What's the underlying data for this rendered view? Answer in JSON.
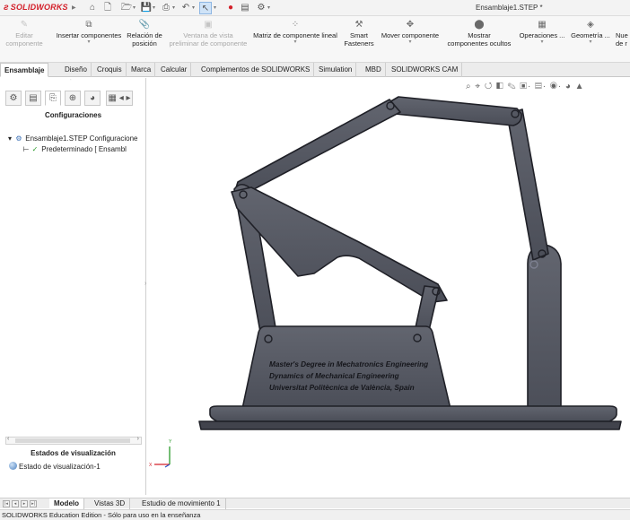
{
  "app": {
    "logo_text": "SOLIDWORKS",
    "window_title": "Ensamblaje1.STEP *"
  },
  "commands": [
    {
      "label_1": "Editar",
      "label_2": "componente",
      "icon": "edit-component-icon",
      "enabled": false
    },
    {
      "label_1": "Insertar componentes",
      "label_2": "",
      "icon": "insert-components-icon",
      "enabled": true
    },
    {
      "label_1": "Relación de",
      "label_2": "posición",
      "icon": "mate-icon",
      "enabled": true
    },
    {
      "label_1": "Ventana de vista",
      "label_2": "preliminar de componente",
      "icon": "preview-window-icon",
      "enabled": false
    },
    {
      "label_1": "Matriz de componente lineal",
      "label_2": "",
      "icon": "linear-pattern-icon",
      "enabled": true
    },
    {
      "label_1": "Smart",
      "label_2": "Fasteners",
      "icon": "smart-fasteners-icon",
      "enabled": true
    },
    {
      "label_1": "Mover componente",
      "label_2": "",
      "icon": "move-component-icon",
      "enabled": true
    },
    {
      "label_1": "Mostrar",
      "label_2": "componentes ocultos",
      "icon": "show-hidden-icon",
      "enabled": true
    },
    {
      "label_1": "Operaciones ...",
      "label_2": "",
      "icon": "features-icon",
      "enabled": true
    },
    {
      "label_1": "Geometría ...",
      "label_2": "",
      "icon": "reference-geometry-icon",
      "enabled": true
    },
    {
      "label_1": "Nue",
      "label_2": "de r",
      "icon": "new-icon",
      "enabled": true
    }
  ],
  "tabs": [
    "Ensamblaje",
    "Diseño",
    "Croquis",
    "Marca",
    "Calcular",
    "Complementos de SOLIDWORKS",
    "Simulation",
    "MBD",
    "SOLIDWORKS CAM"
  ],
  "left_panel": {
    "heading": "Configuraciones",
    "tree": [
      {
        "label": "Ensamblaje1.STEP Configuracione",
        "icon": "assembly-icon"
      },
      {
        "label": "Predeterminado [ Ensambl",
        "icon": "configuration-check-icon"
      }
    ],
    "display_states_title": "Estados de visualización",
    "display_state_item": "Estado de visualización-1"
  },
  "model": {
    "engraving": [
      "Master's Degree in Mechatronics Engineering",
      "Dynamics of Mechanical Engineering",
      "Universitat Politècnica de València, Spain"
    ]
  },
  "bottom_tabs": [
    "Modelo",
    "Vistas 3D",
    "Estudio de movimiento 1"
  ],
  "status_text": "SOLIDWORKS Education Edition - Sólo para uso en la enseñanza",
  "colors": {
    "brand_red": "#d3202a",
    "model_fill": "#565965",
    "model_edge": "#1f2027"
  }
}
